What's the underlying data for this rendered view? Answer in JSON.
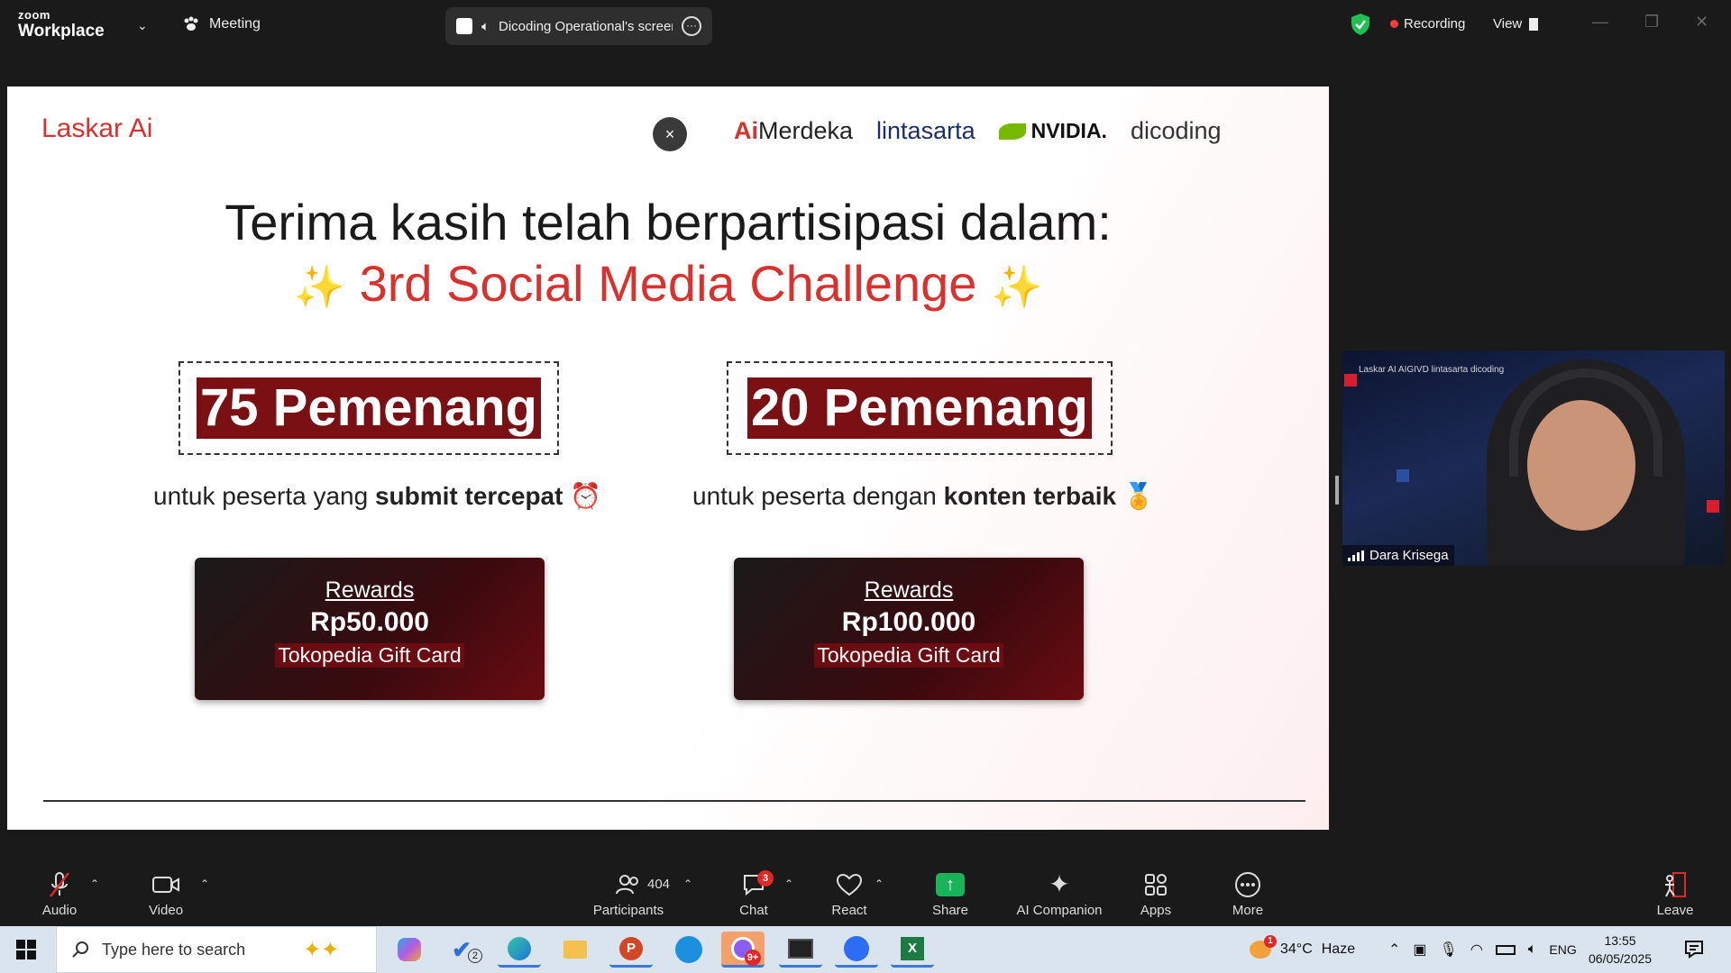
{
  "topbar": {
    "brand_small": "zoom",
    "brand_big": "Workplace",
    "meeting_label": "Meeting",
    "share_label": "Dicoding Operational's screen",
    "recording_label": "Recording",
    "view_label": "View"
  },
  "slide": {
    "brand": "Laskar Ai",
    "close_symbol": "×",
    "partners": {
      "aim_prefix": "Ai",
      "aim_name": "Merdeka",
      "lintasarta": "lintasarta",
      "nvidia": "NVIDIA.",
      "dicoding": "dicoding"
    },
    "title_line1": "Terima kasih telah berpartisipasi dalam:",
    "title_line2": "3rd Social Media Challenge",
    "sparkle": "✨",
    "left": {
      "winners": "75 Pemenang",
      "desc_prefix": "untuk peserta yang ",
      "desc_bold": "submit tercepat",
      "desc_emoji": "⏰",
      "reward_title": "Rewards",
      "reward_amount": "Rp50.000",
      "reward_item": "Tokopedia Gift Card"
    },
    "right": {
      "winners": "20 Pemenang",
      "desc_prefix": "untuk peserta dengan ",
      "desc_bold": "konten terbaik",
      "desc_emoji": "🏅",
      "reward_title": "Rewards",
      "reward_amount": "Rp100.000",
      "reward_item": "Tokopedia Gift Card"
    }
  },
  "video": {
    "participant_name": "Dara Krisega",
    "background_text": "Laskar AI   AIGIVD   lintasarta   dicoding"
  },
  "toolbar": {
    "audio": "Audio",
    "video": "Video",
    "participants": "Participants",
    "participants_count": "404",
    "chat": "Chat",
    "chat_badge": "3",
    "react": "React",
    "share": "Share",
    "ai_companion": "AI Companion",
    "apps": "Apps",
    "more": "More",
    "leave": "Leave"
  },
  "taskbar": {
    "search_placeholder": "Type here to search",
    "weather_temp": "34°C",
    "weather_desc": "Haze",
    "weather_badge": "1",
    "language": "ENG",
    "time": "13:55",
    "date": "06/05/2025",
    "todo_badge": "2",
    "chrome_badge": "9+"
  },
  "colors": {
    "accent_red": "#d9312e",
    "winner_bg": "#7a0f14",
    "nvidia_green": "#76b900",
    "share_green": "#19b35a",
    "rec_dot": "#ff3b3b"
  }
}
